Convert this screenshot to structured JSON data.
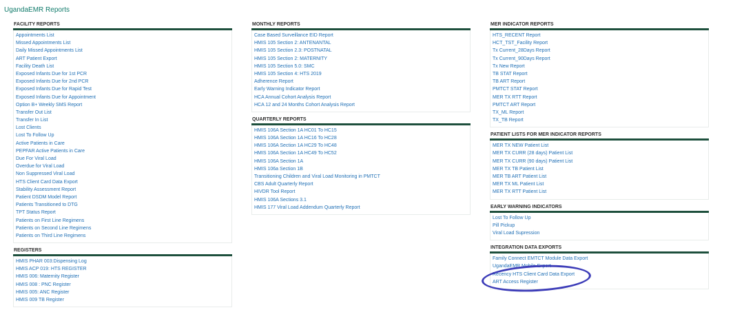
{
  "page_title": "UgandaEMR Reports",
  "colors": {
    "accent": "#0f7a6a",
    "header_rule": "#1d4f3c",
    "link": "#1f6fb5",
    "annotation": "#3c3cb8"
  },
  "facility": {
    "title": "FACILITY REPORTS",
    "items": [
      "Appointments List",
      "Missed Appointments List",
      "Daily Missed Appointments List",
      "ART Patient Export",
      "Facility Death List",
      "Exposed Infants Due for 1st PCR",
      "Exposed Infants Due for 2nd PCR",
      "Exposed Infants Due for Rapid Test",
      "Exposed Infants Due for Appointment",
      "Option B+ Weekly SMS Report",
      "Transfer Out List",
      "Transfer In List",
      "Lost Clients",
      "Lost To Follow Up",
      "Active Patients in Care",
      "PEPFAR Active Patients in Care",
      "Due For Viral Load",
      "Overdue for Viral Load",
      "Non Suppressed Viral Load",
      "HTS Client Card Data Export",
      "Stability Assessment Report",
      "Patient DSDM Model Report",
      "Patients Transitioned to DTG",
      "TPT Status Report",
      "Patients on First Line Regimens",
      "Patients on Second Line Regimens",
      "Patients on Third Line Regimens"
    ]
  },
  "registers": {
    "title": "REGISTERS",
    "items": [
      "HMIS PHAR 003:Dispensing Log",
      "HMIS ACP 019: HTS REGISTER",
      "HMIS 006: Maternity Register",
      "HMIS 008 : PNC Register",
      "HMIS 005: ANC Register",
      "HMIS 009 TB Register"
    ]
  },
  "monthly": {
    "title": "MONTHLY REPORTS",
    "items": [
      "Case Based Surveillance EID Report",
      "HMIS 105 Section 2: ANTENANTAL",
      "HMIS 105 Section 2.3: POSTNATAL",
      "HMIS 105 Section 2: MATERNITY",
      "HMIS 105 Section 5.0: SMC",
      "HMIS 105 Section 4: HTS 2019",
      "Adherence Report",
      "Early Warning Indicator Report",
      "HCA Annual Cohort Analysis Report",
      "HCA 12 and 24 Months Cohort Analysis Report"
    ]
  },
  "quarterly": {
    "title": "QUARTERLY REPORTS",
    "items": [
      "HMIS 106A Section 1A HC01 To HC15",
      "HMIS 106A Section 1A HC16 To HC28",
      "HMIS 106A Section 1A HC29 To HC48",
      "HMIS 106A Section 1A HC49 To HC52",
      "HMIS 106A Section 1A",
      "HMIS 106a Section 1B",
      "Transitioning Children and Viral Load Monitoring in PMTCT",
      "CBS Adult Quarterly Report",
      "HIVDR Tool Report",
      "HMIS 106A Sections 3.1",
      "HMIS 177 Viral Load Addendum Quarterly Report"
    ]
  },
  "mer": {
    "title": "MER INDICATOR REPORTS",
    "items": [
      "HTS_RECENT Report",
      "HCT_TST_Facility Report",
      "Tx Current_28Days Report",
      "Tx Current_90Days Report",
      "Tx New Report",
      "TB STAT Report",
      "TB ART Report",
      "PMTCT STAT Report",
      "MER TX RTT Report",
      "PMTCT ART Report",
      "TX_ML Report",
      "TX_TB Report"
    ]
  },
  "patient_lists": {
    "title": "PATIENT LISTS FOR MER INDICATOR REPORTS",
    "items": [
      "MER TX NEW Patient List",
      "MER TX CURR (28 days) Patient List",
      "MER TX CURR (90 days) Patient List",
      "MER TX TB Patient List",
      "MER TB ART Patient List",
      "MER TX ML Patient List",
      "MER TX RTT Patient List"
    ]
  },
  "early_warning": {
    "title": "EARLY WARNING INDICATORS",
    "items": [
      "Lost To Follow Up",
      "Pill Pickup",
      "Viral Load Supression"
    ]
  },
  "integration": {
    "title": "INTEGRATION DATA EXPORTS",
    "items": [
      "Family Connect EMTCT Module Data Export",
      "UgandaEMR Mobile Export",
      "Recency HTS Client Card Data Export",
      "ART Access Register"
    ]
  }
}
